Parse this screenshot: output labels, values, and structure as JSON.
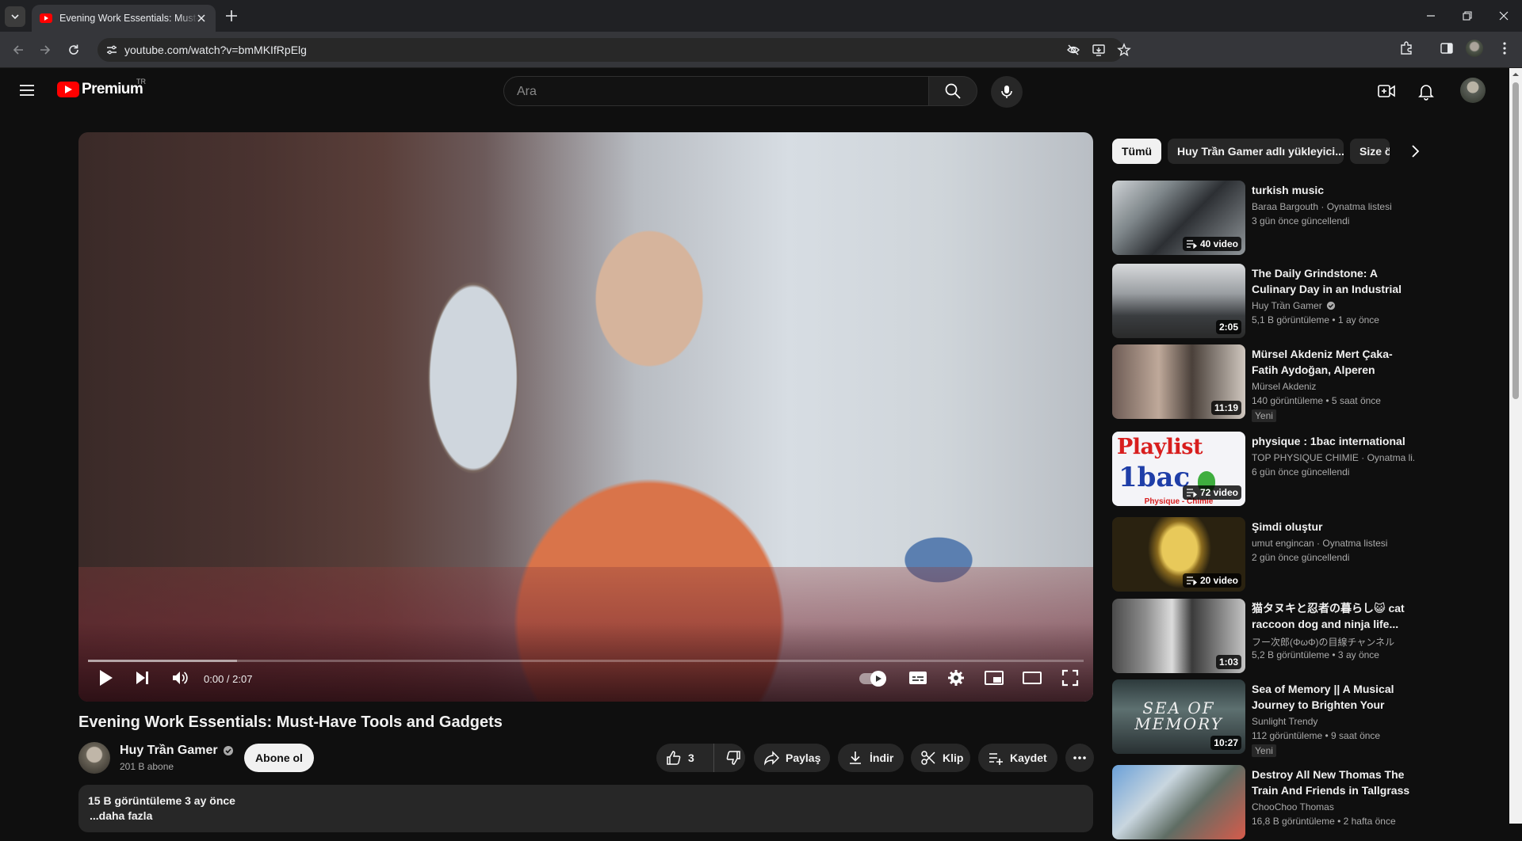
{
  "browser": {
    "tab_title": "Evening Work Essentials: Must-Have Tools and Gadgets - YouTube",
    "url": "youtube.com/watch?v=bmMKIfRpElg"
  },
  "header": {
    "logo_text": "Premium",
    "country_code": "TR",
    "search_placeholder": "Ara"
  },
  "player": {
    "time": "0:00 / 2:07",
    "progress_fraction": 0.0,
    "buffered_fraction": 0.15
  },
  "video": {
    "title": "Evening Work Essentials: Must-Have Tools and Gadgets",
    "channel": "Huy Trần Gamer",
    "subscribers": "201 B abone",
    "subscribe_label": "Abone ol",
    "like_count": "3",
    "share_label": "Paylaş",
    "download_label": "İndir",
    "clip_label": "Klip",
    "save_label": "Kaydet",
    "stats": "15 B görüntüleme  3 ay önce",
    "more_label": "...daha fazla"
  },
  "sidebar": {
    "chips": [
      "Tümü",
      "Huy Trần Gamer adlı yükleyici...",
      "Size ö"
    ],
    "recommendations": [
      {
        "title": "turkish music",
        "meta1": "Baraa Bargouth · Oynatma listesi",
        "meta2": "3 gün önce güncellendi",
        "meta3": "",
        "badge": "40 video",
        "playlist": true,
        "isnew": ""
      },
      {
        "title": "The Daily Grindstone: A Culinary Day in an Industrial Kitchen",
        "meta1": "Huy Trần Gamer",
        "meta2": "5,1 B görüntüleme  • 1 ay önce",
        "meta3": "",
        "badge": "2:05",
        "playlist": false,
        "isnew": "",
        "verified": true
      },
      {
        "title": "Mürsel Akdeniz Mert Çaka- Fatih Aydoğan, Alperen Kalmaz",
        "meta1": "Mürsel Akdeniz",
        "meta2": "140 görüntüleme  • 5 saat önce",
        "meta3": "",
        "badge": "11:19",
        "playlist": false,
        "isnew": "Yeni"
      },
      {
        "title": "physique : 1bac international",
        "meta1": "TOP PHYSIQUE CHIMIE · Oynatma li...",
        "meta2": "6 gün önce güncellendi",
        "meta3": "",
        "badge": "72 video",
        "playlist": true,
        "isnew": "",
        "thumb_text": "Playlist",
        "thumb_text2": "1bac",
        "thumb_caption": "Physique - Chimie"
      },
      {
        "title": "Şimdi oluştur",
        "meta1": "umut engincan · Oynatma listesi",
        "meta2": "2 gün önce güncellendi",
        "meta3": "",
        "badge": "20 video",
        "playlist": true,
        "isnew": ""
      },
      {
        "title": "猫タヌキと忍者の暮らし😺 cat raccoon dog and ninja life...",
        "meta1": "フー次郎(ΦωΦ)の目線チャンネル",
        "meta2": "5,2 B görüntüleme  • 3 ay önce",
        "meta3": "",
        "badge": "1:03",
        "playlist": false,
        "isnew": ""
      },
      {
        "title": "Sea of Memory || A Musical Journey to Brighten Your Moo...",
        "meta1": "Sunlight Trendy",
        "meta2": "112 görüntüleme  • 9 saat önce",
        "meta3": "",
        "badge": "10:27",
        "playlist": false,
        "isnew": "Yeni",
        "thumb_text": "SEA OF MEMORY"
      },
      {
        "title": "Destroy All New Thomas The Train And Friends in Tallgrass ...",
        "meta1": "ChooChoo Thomas",
        "meta2": "16,8 B görüntüleme  • 2 hafta önce",
        "meta3": "",
        "badge": "",
        "playlist": false,
        "isnew": ""
      }
    ]
  }
}
